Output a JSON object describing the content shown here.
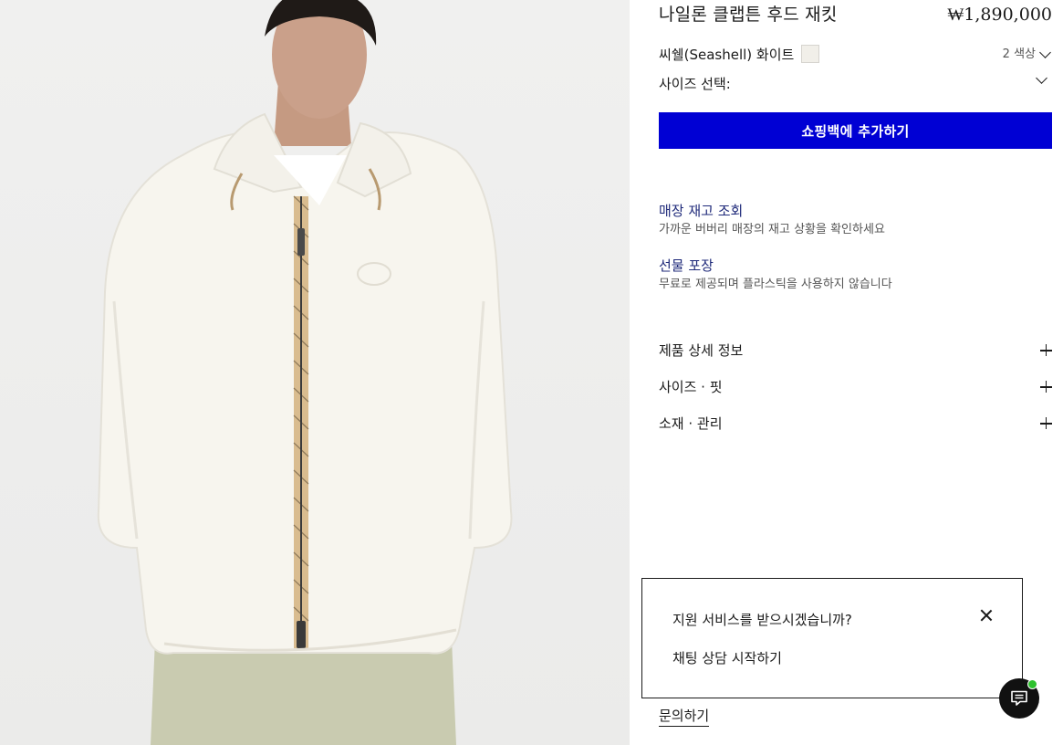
{
  "product": {
    "title": "나일론 클랩튼 후드 재킷",
    "price": "₩1,890,000",
    "color_name": "씨쉘(Seashell) 화이트",
    "color_count": "2 색상",
    "size_label": "사이즈 선택:",
    "add_to_bag": "쇼핑백에 추가하기"
  },
  "services": {
    "store_title": "매장 재고 조회",
    "store_desc": "가까운 버버리 매장의 재고 상황을 확인하세요",
    "gift_title": "선물 포장",
    "gift_desc": "무료로 제공되며 플라스틱을 사용하지 않습니다"
  },
  "accordion": [
    {
      "label": "제품 상세 정보"
    },
    {
      "label": "사이즈 · 핏"
    },
    {
      "label": "소재 · 관리"
    }
  ],
  "inquiry_link": "문의하기",
  "chat": {
    "question": "지원 서비스를 받으시겠습니까?",
    "start": "채팅 상담 시작하기"
  },
  "colors": {
    "primary_button": "#0000d4",
    "service_title": "#1f2a7a",
    "swatch": "#f1efe9",
    "online": "#2ec22e"
  },
  "icons": [
    "chevron-down-icon",
    "plus-icon",
    "close-icon",
    "chat-icon"
  ]
}
